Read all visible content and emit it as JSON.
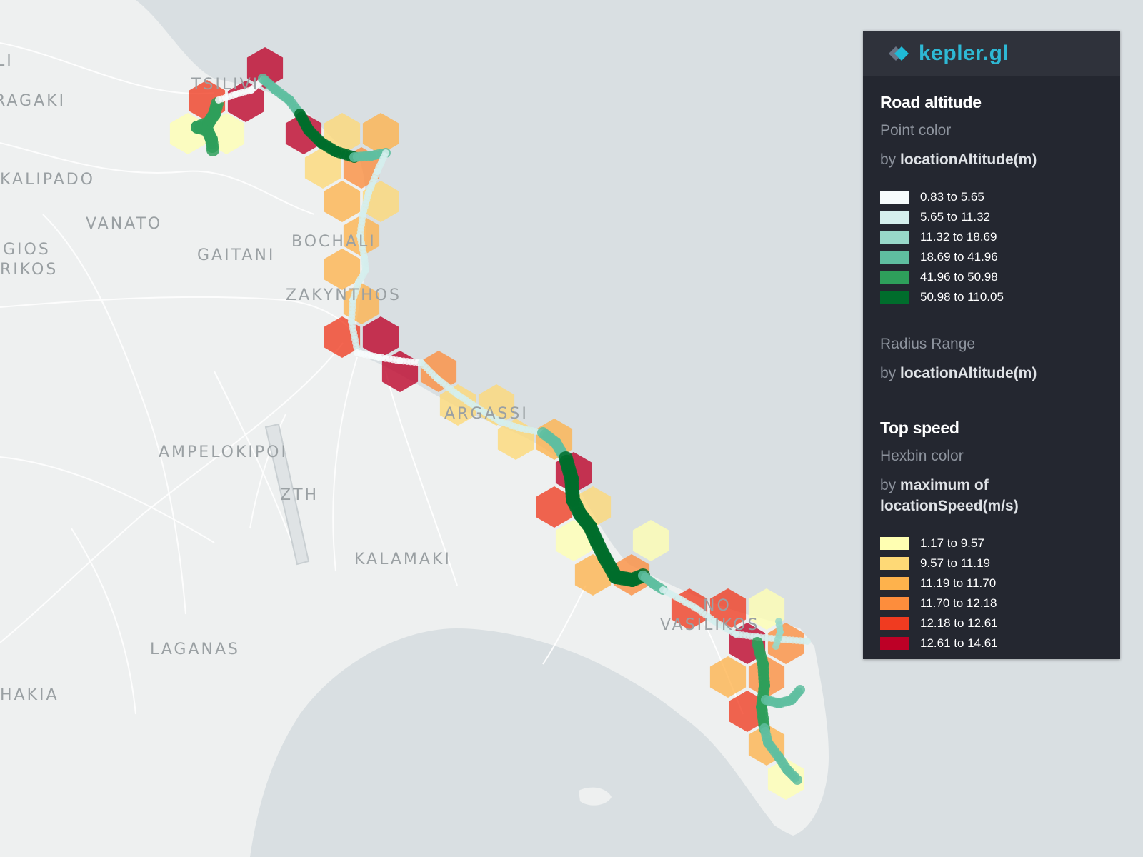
{
  "map": {
    "place_labels": [
      {
        "text": "LI",
        "name": "li"
      },
      {
        "text": "RAGAKI",
        "name": "ragaki"
      },
      {
        "text": "TSILIVI",
        "name": "tsilivi"
      },
      {
        "text": "KALIPADO",
        "name": "kalipado"
      },
      {
        "text": "VANATO",
        "name": "vanato"
      },
      {
        "text": "GIOS",
        "name": "gios"
      },
      {
        "text": "RIKOS",
        "name": "rikos"
      },
      {
        "text": "GAITANI",
        "name": "gaitani"
      },
      {
        "text": "BOCHALI",
        "name": "bochali"
      },
      {
        "text": "ZAKYNTHOS",
        "name": "zakynthos"
      },
      {
        "text": "ARGASSI",
        "name": "argassi"
      },
      {
        "text": "AMPELOKIPOI",
        "name": "ampelokipoi"
      },
      {
        "text": "ZTH",
        "name": "zth"
      },
      {
        "text": "KALAMAKI",
        "name": "kalamaki"
      },
      {
        "text": "LAGANAS",
        "name": "laganas"
      },
      {
        "text": "HAKIA",
        "name": "hakia"
      },
      {
        "text": "NO",
        "name": "no"
      },
      {
        "text": "VASILIKOS",
        "name": "vasilikos"
      }
    ],
    "colors": {
      "sea": "#d9dfe2",
      "land": "#eef0f0",
      "roads": "#ffffff"
    }
  },
  "legend": {
    "logo_text": "kepler.gl",
    "logo_icon": "kepler-diamond-icon",
    "layers": [
      {
        "title": "Road altitude",
        "properties": [
          {
            "label": "Point color",
            "by_prefix": "by ",
            "by_field": "locationAltitude(m)",
            "scale": [
              {
                "range": "0.83 to 5.65",
                "color": "#f7fcfd"
              },
              {
                "range": "5.65 to 11.32",
                "color": "#d5efed"
              },
              {
                "range": "11.32 to 18.69",
                "color": "#98d8c9"
              },
              {
                "range": "18.69 to 41.96",
                "color": "#5fbea0"
              },
              {
                "range": "41.96 to 50.98",
                "color": "#2e9f5b"
              },
              {
                "range": "50.98 to 110.05",
                "color": "#006d2c"
              }
            ]
          },
          {
            "label": "Radius Range",
            "by_prefix": "by ",
            "by_field": "locationAltitude(m)"
          }
        ]
      },
      {
        "title": "Top speed",
        "properties": [
          {
            "label": "Hexbin color",
            "by_prefix": "by ",
            "by_field": "maximum of locationSpeed(m/s)",
            "scale": [
              {
                "range": "1.17 to 9.57",
                "color": "#ffffb2"
              },
              {
                "range": "9.57 to 11.19",
                "color": "#fed976"
              },
              {
                "range": "11.19 to 11.70",
                "color": "#feb24c"
              },
              {
                "range": "11.70 to 12.18",
                "color": "#fd8d3c"
              },
              {
                "range": "12.18 to 12.61",
                "color": "#f03b20"
              },
              {
                "range": "12.61 to 14.61",
                "color": "#bd0026"
              }
            ]
          }
        ]
      }
    ]
  },
  "hexbins": [
    {
      "speed_class": 5
    },
    {
      "speed_class": 5
    },
    {
      "speed_class": 4
    },
    {
      "speed_class": 0
    },
    {
      "speed_class": 0
    },
    {
      "speed_class": 5
    },
    {
      "speed_class": 1
    },
    {
      "speed_class": 2
    },
    {
      "speed_class": 1
    },
    {
      "speed_class": 3
    },
    {
      "speed_class": 2
    },
    {
      "speed_class": 1
    },
    {
      "speed_class": 2
    },
    {
      "speed_class": 2
    },
    {
      "speed_class": 2
    },
    {
      "speed_class": 4
    },
    {
      "speed_class": 5
    },
    {
      "speed_class": 5
    },
    {
      "speed_class": 3
    },
    {
      "speed_class": 1
    },
    {
      "speed_class": 1
    },
    {
      "speed_class": 1
    },
    {
      "speed_class": 2
    },
    {
      "speed_class": 5
    },
    {
      "speed_class": 4
    },
    {
      "speed_class": 1
    },
    {
      "speed_class": 0
    },
    {
      "speed_class": 2
    },
    {
      "speed_class": 3
    },
    {
      "speed_class": 0
    },
    {
      "speed_class": 4
    },
    {
      "speed_class": 4
    },
    {
      "speed_class": 0
    },
    {
      "speed_class": 5
    },
    {
      "speed_class": 3
    },
    {
      "speed_class": 2
    },
    {
      "speed_class": 3
    },
    {
      "speed_class": 4
    },
    {
      "speed_class": 2
    },
    {
      "speed_class": 0
    }
  ]
}
